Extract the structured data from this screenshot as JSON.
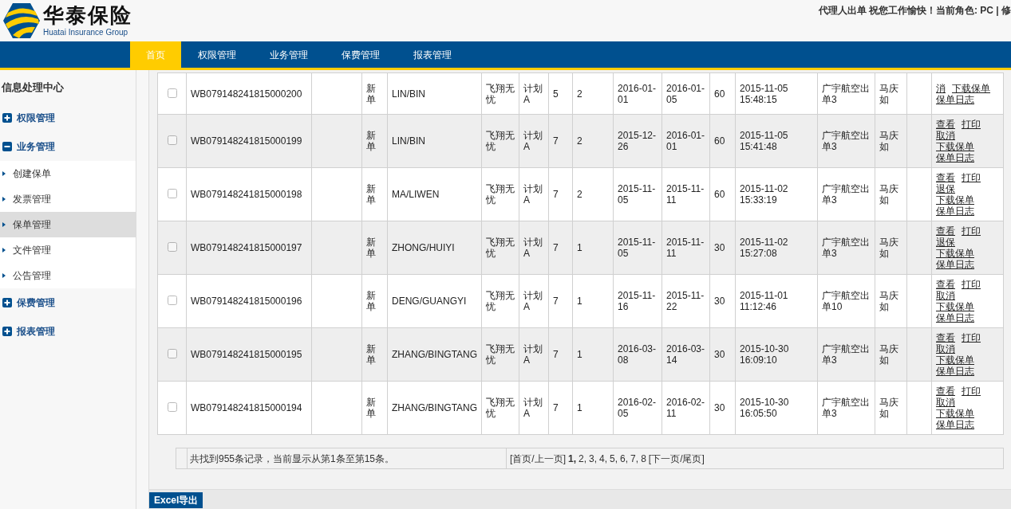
{
  "header": {
    "logo_title": "华泰保险",
    "logo_subtitle": "Huatai Insurance Group",
    "greeting": "代理人出单 祝您工作愉快！当前角色: PC | 修"
  },
  "nav": [
    {
      "label": "首页",
      "selected": true
    },
    {
      "label": "权限管理",
      "selected": false
    },
    {
      "label": "业务管理",
      "selected": false
    },
    {
      "label": "保费管理",
      "selected": false
    },
    {
      "label": "报表管理",
      "selected": false
    }
  ],
  "sidebar": {
    "title": "信息处理中心",
    "groups": [
      {
        "label": "权限管理",
        "expanded": false
      },
      {
        "label": "业务管理",
        "expanded": true,
        "children": [
          {
            "label": "创建保单",
            "selected": false
          },
          {
            "label": "发票管理",
            "selected": false
          },
          {
            "label": "保单管理",
            "selected": true
          },
          {
            "label": "文件管理",
            "selected": false
          },
          {
            "label": "公告管理",
            "selected": false
          }
        ]
      },
      {
        "label": "保费管理",
        "expanded": false
      },
      {
        "label": "报表管理",
        "expanded": false
      }
    ]
  },
  "table": {
    "rows": [
      {
        "checked": false,
        "policy_no": "WB079148241815000200",
        "type": "新单",
        "insured": "LIN/BIN",
        "product": "飞翔无忧",
        "plan": "计划A",
        "column_8": "5",
        "column_9": "2",
        "start": "2016-01-01",
        "end": "2016-01-05",
        "days": "60",
        "issued": "2015-11-05 15:48:15",
        "agent": "广宇航空出单3",
        "operator": "马庆如",
        "actions": [
          "消",
          "下载保单",
          "保单日志"
        ]
      },
      {
        "checked": false,
        "policy_no": "WB079148241815000199",
        "type": "新单",
        "insured": "LIN/BIN",
        "product": "飞翔无忧",
        "plan": "计划A",
        "column_8": "7",
        "column_9": "2",
        "start": "2015-12-26",
        "end": "2016-01-01",
        "days": "60",
        "issued": "2015-11-05 15:41:48",
        "agent": "广宇航空出单3",
        "operator": "马庆如",
        "actions": [
          "查看",
          "打印",
          "取消",
          "下载保单",
          "保单日志"
        ]
      },
      {
        "checked": false,
        "policy_no": "WB079148241815000198",
        "type": "新单",
        "insured": "MA/LIWEN",
        "product": "飞翔无忧",
        "plan": "计划A",
        "column_8": "7",
        "column_9": "2",
        "start": "2015-11-05",
        "end": "2015-11-11",
        "days": "60",
        "issued": "2015-11-02 15:33:19",
        "agent": "广宇航空出单3",
        "operator": "马庆如",
        "actions": [
          "查看",
          "打印",
          "退保",
          "下载保单",
          "保单日志"
        ]
      },
      {
        "checked": false,
        "policy_no": "WB079148241815000197",
        "type": "新单",
        "insured": "ZHONG/HUIYI",
        "product": "飞翔无忧",
        "plan": "计划A",
        "column_8": "7",
        "column_9": "1",
        "start": "2015-11-05",
        "end": "2015-11-11",
        "days": "30",
        "issued": "2015-11-02 15:27:08",
        "agent": "广宇航空出单3",
        "operator": "马庆如",
        "actions": [
          "查看",
          "打印",
          "退保",
          "下载保单",
          "保单日志"
        ]
      },
      {
        "checked": false,
        "policy_no": "WB079148241815000196",
        "type": "新单",
        "insured": "DENG/GUANGYI",
        "product": "飞翔无忧",
        "plan": "计划A",
        "column_8": "7",
        "column_9": "1",
        "start": "2015-11-16",
        "end": "2015-11-22",
        "days": "30",
        "issued": "2015-11-01 11:12:46",
        "agent": "广宇航空出单10",
        "operator": "马庆如",
        "actions": [
          "查看",
          "打印",
          "取消",
          "下载保单",
          "保单日志"
        ]
      },
      {
        "checked": false,
        "policy_no": "WB079148241815000195",
        "type": "新单",
        "insured": "ZHANG/BINGTANG",
        "product": "飞翔无忧",
        "plan": "计划A",
        "column_8": "7",
        "column_9": "1",
        "start": "2016-03-08",
        "end": "2016-03-14",
        "days": "30",
        "issued": "2015-10-30 16:09:10",
        "agent": "广宇航空出单3",
        "operator": "马庆如",
        "actions": [
          "查看",
          "打印",
          "取消",
          "下载保单",
          "保单日志"
        ]
      },
      {
        "checked": false,
        "policy_no": "WB079148241815000194",
        "type": "新单",
        "insured": "ZHANG/BINGTANG",
        "product": "飞翔无忧",
        "plan": "计划A",
        "column_8": "7",
        "column_9": "1",
        "start": "2016-02-05",
        "end": "2016-02-11",
        "days": "30",
        "issued": "2015-10-30 16:05:50",
        "agent": "广宇航空出单3",
        "operator": "马庆如",
        "actions": [
          "查看",
          "打印",
          "取消",
          "下载保单",
          "保单日志"
        ]
      }
    ]
  },
  "pager": {
    "summary": "共找到955条记录，当前显示从第1条至第15条。",
    "first_prev": "[首页/上一页]",
    "pages": [
      {
        "label": "1,",
        "selected": true
      },
      {
        "label": "2,",
        "selected": false
      },
      {
        "label": "3,",
        "selected": false
      },
      {
        "label": "4,",
        "selected": false
      },
      {
        "label": "5,",
        "selected": false
      },
      {
        "label": "6,",
        "selected": false
      },
      {
        "label": "7,",
        "selected": false
      },
      {
        "label": "8",
        "selected": false
      }
    ],
    "next_last": "[下一页/尾页]"
  },
  "export_button": "Excel导出"
}
